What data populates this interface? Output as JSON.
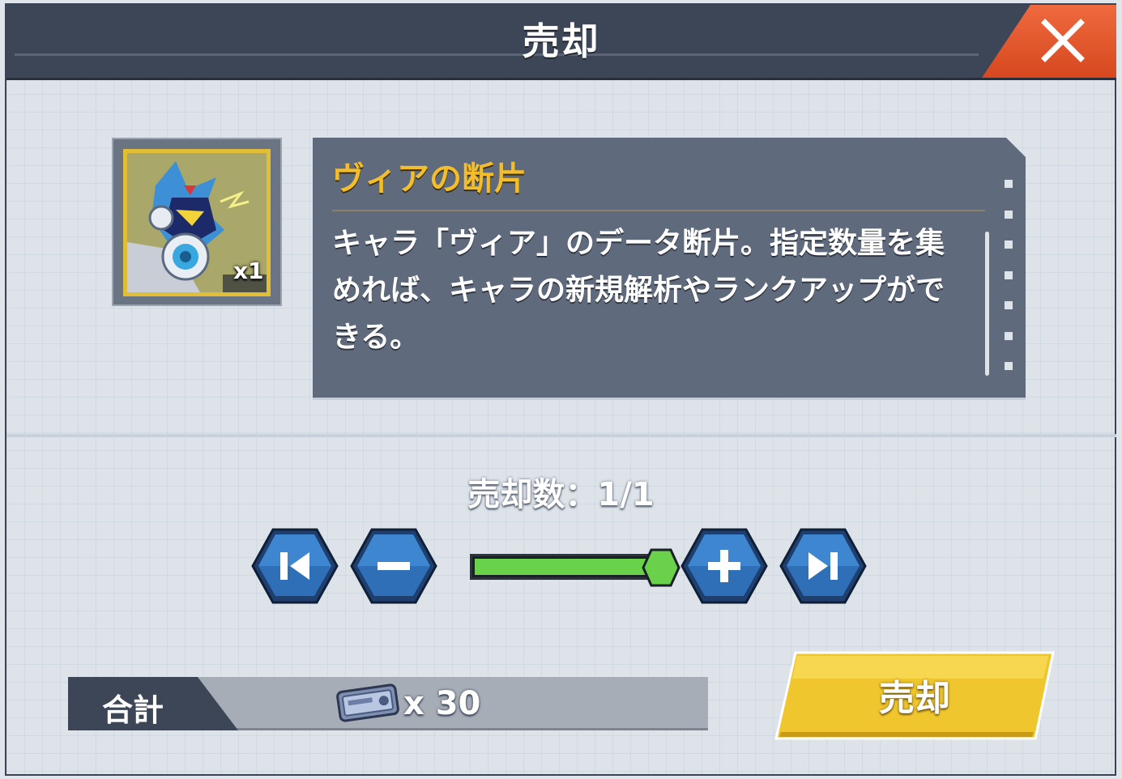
{
  "dialog": {
    "title": "売却",
    "close_icon": "close-icon"
  },
  "item": {
    "name": "ヴィアの断片",
    "owned_badge": "x1",
    "portrait_icon": "character-portrait-via",
    "description": "キャラ「ヴィア」のデータ断片。指定数量を集めれば、キャラの新規解析やランクアップができる。"
  },
  "quantity": {
    "label": "売却数：1/1",
    "selected": 1,
    "max": 1,
    "slider_fraction": 1.0,
    "buttons": {
      "min": "skip-to-min-icon",
      "decrement": "minus-icon",
      "increment": "plus-icon",
      "max": "skip-to-max-icon"
    }
  },
  "total": {
    "label": "合計",
    "currency_icon": "ticket-icon",
    "amount": "x 30"
  },
  "sell_button": {
    "label": "売却"
  },
  "colors": {
    "accent_gold": "#f3bd2c",
    "close_red": "#e0552c",
    "slider_green": "#6ad14a",
    "panel_slate": "#5f6b7c",
    "button_blue": "#2f6fb8"
  }
}
